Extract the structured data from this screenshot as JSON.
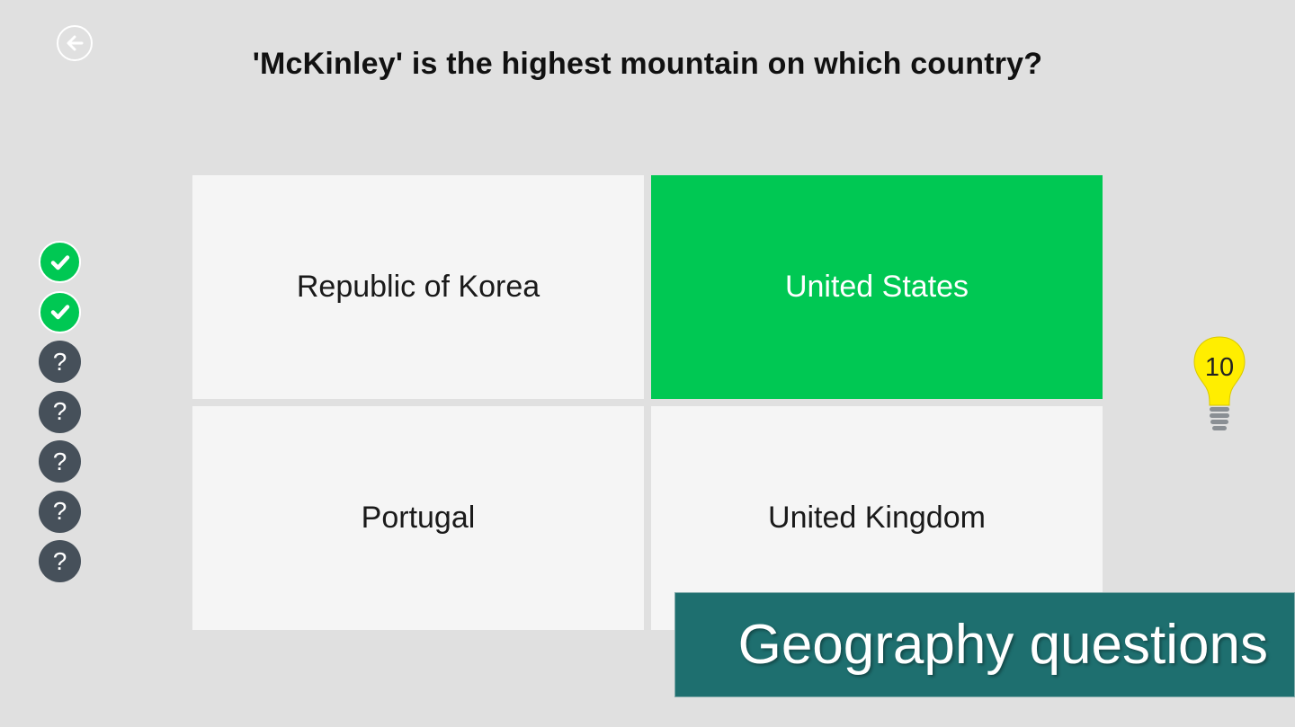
{
  "question": "'McKinley' is the highest mountain on which country?",
  "answers": [
    {
      "label": "Republic of Korea",
      "state": "default"
    },
    {
      "label": "United States",
      "state": "correct"
    },
    {
      "label": "Portugal",
      "state": "default"
    },
    {
      "label": "United Kingdom",
      "state": "default"
    }
  ],
  "progress": [
    {
      "state": "correct",
      "icon": "check-icon"
    },
    {
      "state": "correct",
      "icon": "check-icon"
    },
    {
      "state": "unanswered",
      "symbol": "?"
    },
    {
      "state": "unanswered",
      "symbol": "?"
    },
    {
      "state": "unanswered",
      "symbol": "?"
    },
    {
      "state": "unanswered",
      "symbol": "?"
    },
    {
      "state": "unanswered",
      "symbol": "?"
    }
  ],
  "hint": {
    "count": "10",
    "icon": "lightbulb-icon"
  },
  "back": {
    "icon": "arrow-left-icon"
  },
  "banner": {
    "text": "Geography questions"
  },
  "colors": {
    "background": "#e0e0e0",
    "correct": "#00c853",
    "unanswered": "#46505a",
    "tile": "#f5f5f5",
    "banner": "#1e6f6f",
    "bulb": "#ffee00"
  }
}
